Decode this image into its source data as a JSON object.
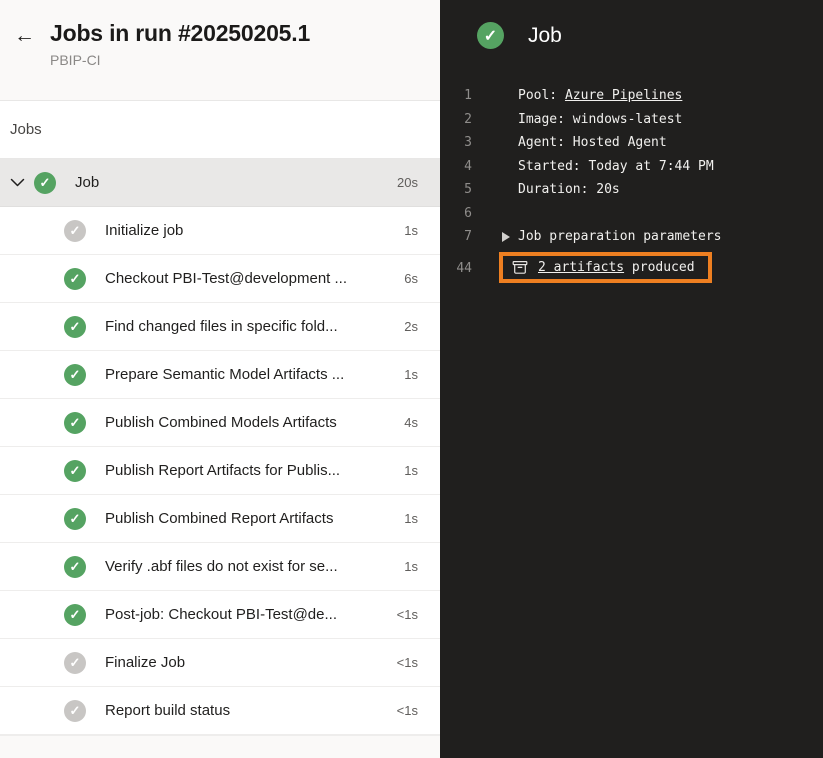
{
  "colors": {
    "success_green": "#55a362",
    "neutral_gray": "#c8c6c4",
    "highlight_orange": "#ee7f21",
    "log_background": "#201f1e"
  },
  "icons": {
    "back": "←",
    "check": "✓",
    "chevron_down": "chevron-down",
    "collapsed_marker": "triangle-right",
    "artifact": "package-box"
  },
  "header": {
    "title": "Jobs in run #20250205.1",
    "subtitle": "PBIP-CI"
  },
  "jobs_panel": {
    "section_label": "Jobs",
    "job": {
      "label": "Job",
      "duration": "20s",
      "status": "success"
    },
    "steps": [
      {
        "label": "Initialize job",
        "duration": "1s",
        "status": "neutral"
      },
      {
        "label": "Checkout PBI-Test@development ...",
        "duration": "6s",
        "status": "success"
      },
      {
        "label": "Find changed files in specific fold...",
        "duration": "2s",
        "status": "success"
      },
      {
        "label": "Prepare Semantic Model Artifacts ...",
        "duration": "1s",
        "status": "success"
      },
      {
        "label": "Publish Combined Models Artifacts",
        "duration": "4s",
        "status": "success"
      },
      {
        "label": "Publish Report Artifacts for Publis...",
        "duration": "1s",
        "status": "success"
      },
      {
        "label": "Publish Combined Report Artifacts",
        "duration": "1s",
        "status": "success"
      },
      {
        "label": "Verify .abf files do not exist for se...",
        "duration": "1s",
        "status": "success"
      },
      {
        "label": "Post-job: Checkout PBI-Test@de...",
        "duration": "<1s",
        "status": "success"
      },
      {
        "label": "Finalize Job",
        "duration": "<1s",
        "status": "neutral"
      },
      {
        "label": "Report build status",
        "duration": "<1s",
        "status": "neutral"
      }
    ]
  },
  "log_panel": {
    "header": {
      "label": "Job",
      "status": "success"
    },
    "lines": [
      {
        "num": "1",
        "prefix": "Pool: ",
        "link": "Azure Pipelines"
      },
      {
        "num": "2",
        "text": "Image: windows-latest"
      },
      {
        "num": "3",
        "text": "Agent: Hosted Agent"
      },
      {
        "num": "4",
        "text": "Started: Today at 7:44 PM"
      },
      {
        "num": "5",
        "text": "Duration: 20s"
      },
      {
        "num": "6",
        "text": ""
      },
      {
        "num": "7",
        "text": "Job preparation parameters",
        "collapsed": true
      },
      {
        "num": "44",
        "artifact_link": "2 artifacts",
        "artifact_suffix": " produced"
      }
    ]
  }
}
